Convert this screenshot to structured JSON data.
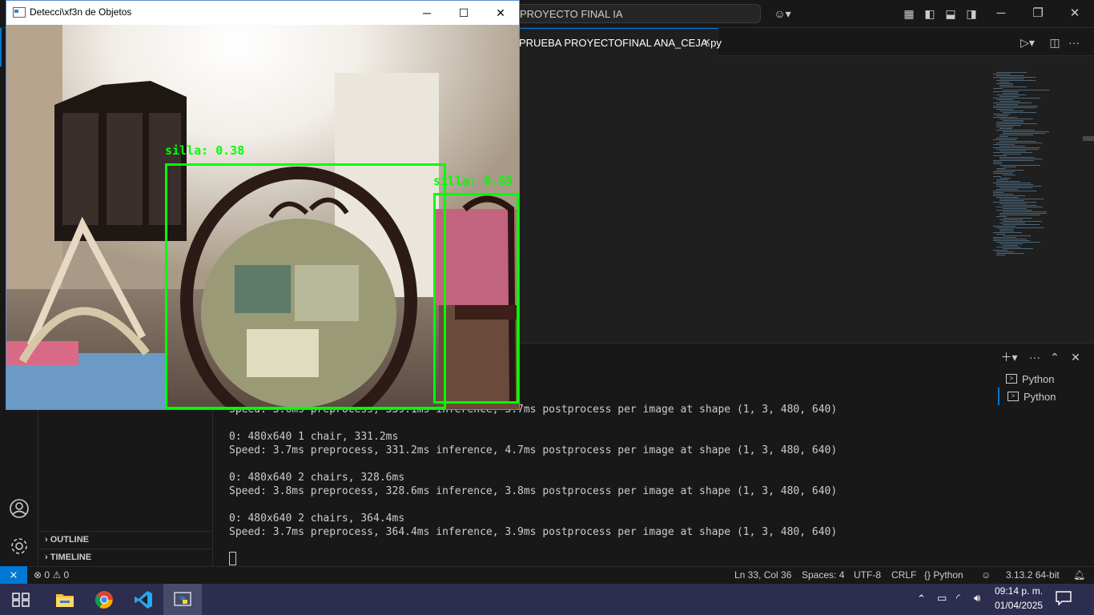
{
  "vscode": {
    "command_center": "PROYECTO FINAL IA",
    "active_tab": "PRUEBA PROYECTOFINAL ANA_CEJA.py",
    "sidebar_sections": [
      "OUTLINE",
      "TIMELINE"
    ],
    "terminal_lines": [
      "Speed: 3.6ms preprocess, 339.1ms inference, 3.7ms postprocess per image at shape (1, 3, 480, 640)",
      "",
      "0: 480x640 1 chair, 331.2ms",
      "Speed: 3.7ms preprocess, 331.2ms inference, 4.7ms postprocess per image at shape (1, 3, 480, 640)",
      "",
      "0: 480x640 2 chairs, 328.6ms",
      "Speed: 3.8ms preprocess, 328.6ms inference, 3.8ms postprocess per image at shape (1, 3, 480, 640)",
      "",
      "0: 480x640 2 chairs, 364.4ms",
      "Speed: 3.7ms preprocess, 364.4ms inference, 3.9ms postprocess per image at shape (1, 3, 480, 640)"
    ],
    "terminals": [
      "Python",
      "Python"
    ],
    "status": {
      "errors": "0",
      "warnings": "0",
      "position": "Ln 33, Col 36",
      "spaces": "Spaces: 4",
      "encoding": "UTF-8",
      "eol": "CRLF",
      "language": "{} Python",
      "interpreter": "3.13.2 64-bit"
    }
  },
  "cv_window": {
    "title": "Detecci\\xf3n de Objetos",
    "detections": [
      {
        "label": "silla: 0.38"
      },
      {
        "label": "silla: 0.85"
      }
    ]
  },
  "taskbar": {
    "time": "09:14 p. m.",
    "date": "01/04/2025"
  },
  "colors": {
    "accent": "#0078d4",
    "detection": "#00ff00"
  }
}
